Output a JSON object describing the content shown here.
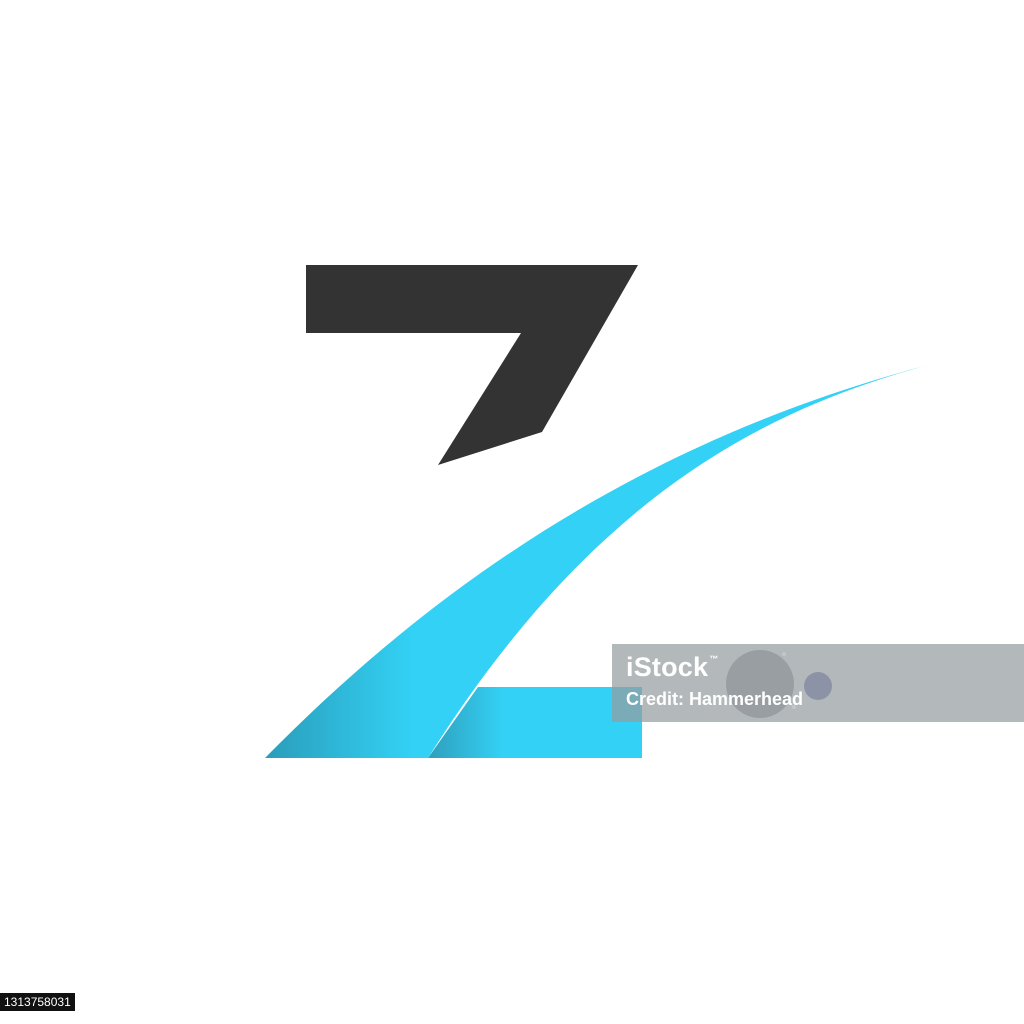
{
  "logo": {
    "letter": "Z",
    "colors": {
      "top_stroke": "#333333",
      "swoosh_light": "#33D1F5",
      "swoosh_dark": "#2A9DBA",
      "background": "#FFFFFF"
    }
  },
  "watermark": {
    "brand": "iStock",
    "trademark": "™",
    "credit": "Credit: Hammerhead"
  },
  "image_id": "1313758031"
}
